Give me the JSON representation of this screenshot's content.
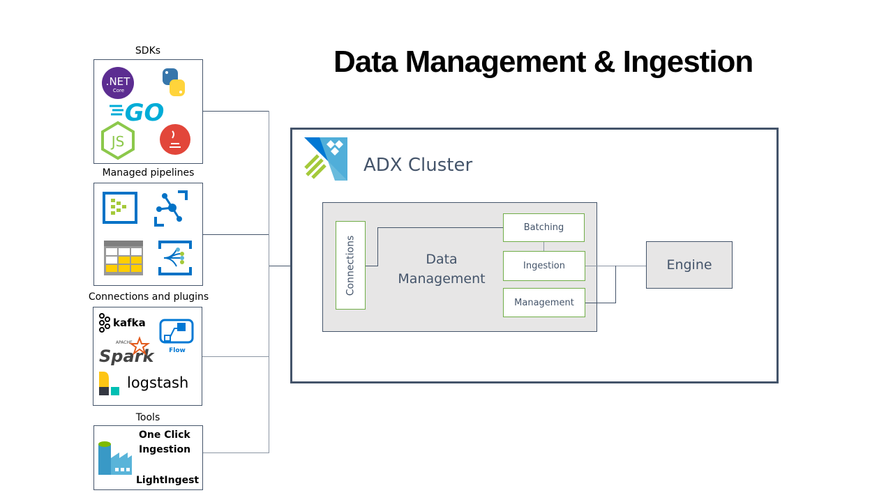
{
  "title": "Data Management & Ingestion",
  "groups": {
    "sdks": {
      "label": "SDKs",
      "icons": [
        {
          "name": "dotnet-core-icon",
          "text": ".NET",
          "subtext": "Core"
        },
        {
          "name": "python-icon"
        },
        {
          "name": "go-icon",
          "text": "GO"
        },
        {
          "name": "nodejs-icon",
          "text": "JS"
        },
        {
          "name": "java-icon"
        }
      ]
    },
    "pipelines": {
      "label": "Managed pipelines",
      "icons": [
        {
          "name": "event-hubs-icon"
        },
        {
          "name": "event-grid-icon"
        },
        {
          "name": "iot-hub-table-icon"
        },
        {
          "name": "stream-analytics-icon"
        }
      ]
    },
    "connections": {
      "label": "Connections and plugins",
      "icons": [
        {
          "name": "kafka-icon",
          "text": "kafka"
        },
        {
          "name": "flow-icon",
          "text": "Flow"
        },
        {
          "name": "spark-icon",
          "text": "Spark",
          "subtext": "APACHE"
        },
        {
          "name": "logstash-icon",
          "text": "logstash"
        }
      ]
    },
    "tools": {
      "label": "Tools",
      "items": [
        "One Click",
        "Ingestion",
        "LightIngest"
      ]
    }
  },
  "cluster": {
    "title": "ADX Cluster",
    "data_management": {
      "label_line1": "Data",
      "label_line2": "Management",
      "connections": "Connections",
      "batching": "Batching",
      "ingestion": "Ingestion",
      "management": "Management"
    },
    "engine": "Engine"
  },
  "colors": {
    "border": "#44546a",
    "green": "#70ad47",
    "box_fill": "#e7e6e6"
  }
}
